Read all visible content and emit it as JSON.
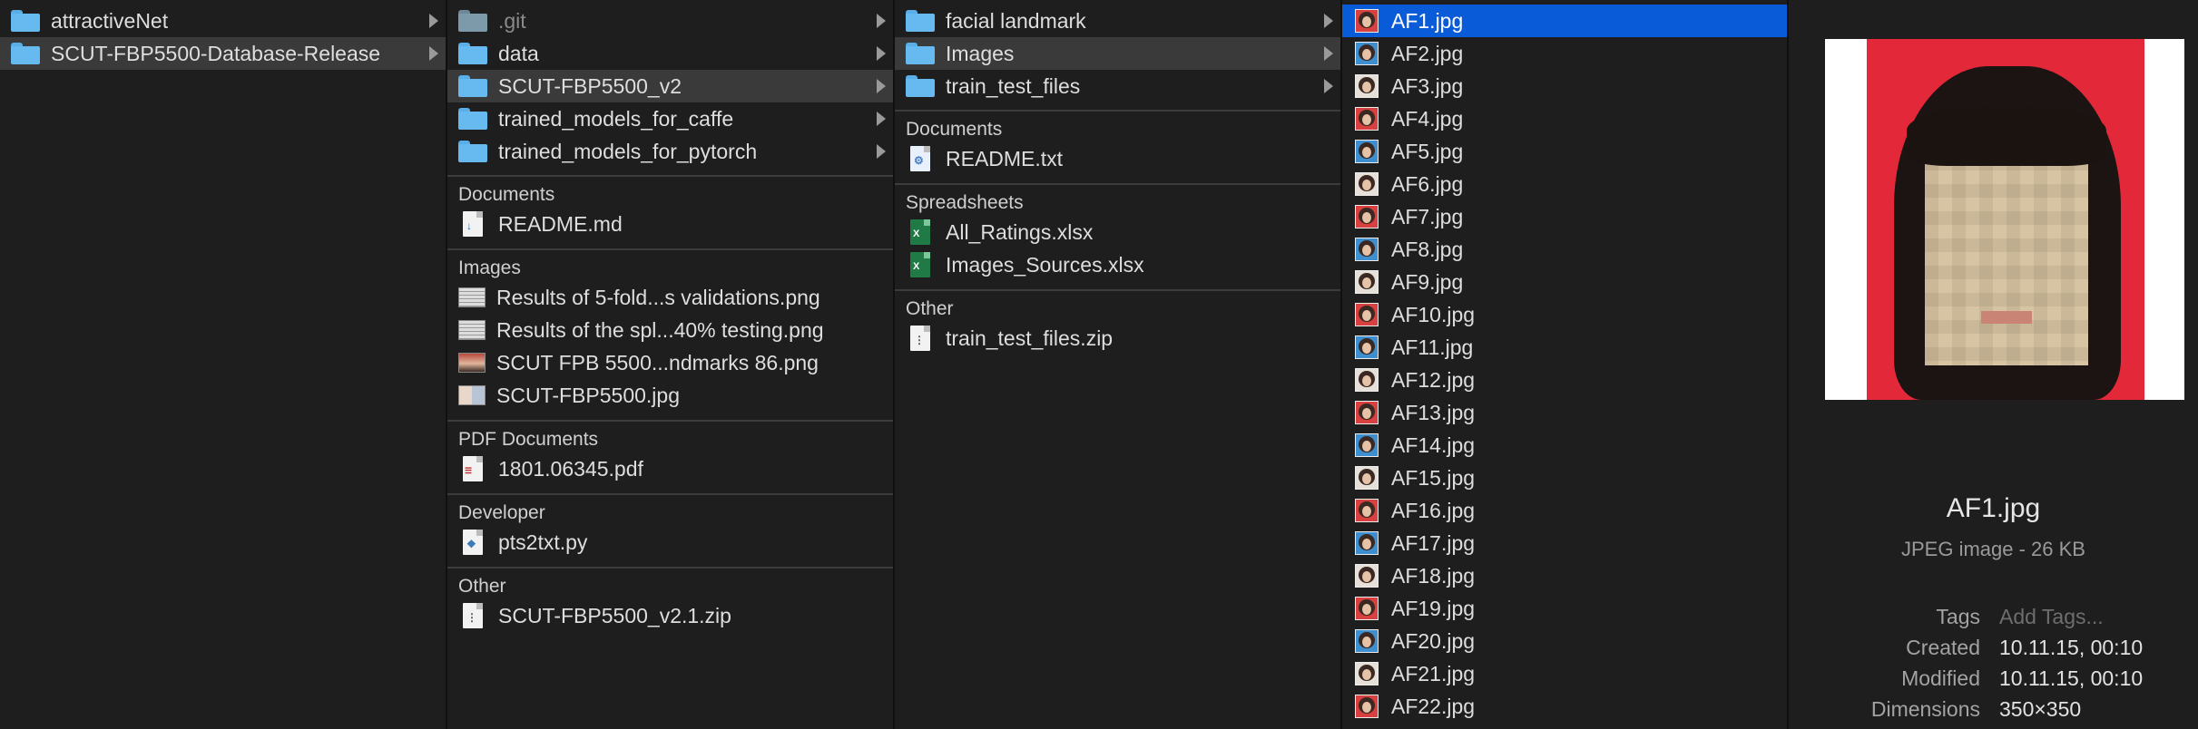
{
  "column1": {
    "items": [
      {
        "label": "attractiveNet"
      },
      {
        "label": "SCUT-FBP5500-Database-Release"
      }
    ]
  },
  "column2": {
    "folders": [
      {
        "label": ".git"
      },
      {
        "label": "data"
      },
      {
        "label": "SCUT-FBP5500_v2"
      },
      {
        "label": "trained_models_for_caffe"
      },
      {
        "label": "trained_models_for_pytorch"
      }
    ],
    "sections": {
      "documents": {
        "title": "Documents",
        "items": [
          "README.md"
        ]
      },
      "images": {
        "title": "Images",
        "items": [
          "Results of 5-fold...s validations.png",
          "Results of the spl...40% testing.png",
          "SCUT FPB 5500...ndmarks 86.png",
          "SCUT-FBP5500.jpg"
        ]
      },
      "pdf": {
        "title": "PDF Documents",
        "items": [
          "1801.06345.pdf"
        ]
      },
      "developer": {
        "title": "Developer",
        "items": [
          "pts2txt.py"
        ]
      },
      "other": {
        "title": "Other",
        "items": [
          "SCUT-FBP5500_v2.1.zip"
        ]
      }
    }
  },
  "column3": {
    "folders": [
      {
        "label": "facial landmark"
      },
      {
        "label": "Images"
      },
      {
        "label": "train_test_files"
      }
    ],
    "sections": {
      "documents": {
        "title": "Documents",
        "items": [
          "README.txt"
        ]
      },
      "spreadsheets": {
        "title": "Spreadsheets",
        "items": [
          "All_Ratings.xlsx",
          "Images_Sources.xlsx"
        ]
      },
      "other": {
        "title": "Other",
        "items": [
          "train_test_files.zip"
        ]
      }
    }
  },
  "column4": {
    "files": [
      "AF1.jpg",
      "AF2.jpg",
      "AF3.jpg",
      "AF4.jpg",
      "AF5.jpg",
      "AF6.jpg",
      "AF7.jpg",
      "AF8.jpg",
      "AF9.jpg",
      "AF10.jpg",
      "AF11.jpg",
      "AF12.jpg",
      "AF13.jpg",
      "AF14.jpg",
      "AF15.jpg",
      "AF16.jpg",
      "AF17.jpg",
      "AF18.jpg",
      "AF19.jpg",
      "AF20.jpg",
      "AF21.jpg",
      "AF22.jpg"
    ]
  },
  "preview": {
    "filename": "AF1.jpg",
    "kind": "JPEG image - 26 KB",
    "meta": {
      "tags_label": "Tags",
      "tags_value": "Add Tags...",
      "created_label": "Created",
      "created_value": "10.11.15, 00:10",
      "modified_label": "Modified",
      "modified_value": "10.11.15, 00:10",
      "dimensions_label": "Dimensions",
      "dimensions_value": "350×350"
    }
  },
  "colors": {
    "selection_blue": "#0a5bd7",
    "selection_grey": "#3a3a3a",
    "folder_blue": "#67baf0",
    "background": "#1e1e1e"
  },
  "icons": {
    "folder": "folder-icon",
    "chevron": "chevron-right-icon",
    "markdown": "markdown-file-icon",
    "png": "image-file-icon",
    "pdf": "pdf-file-icon",
    "python": "python-file-icon",
    "zip": "zip-file-icon",
    "text": "text-file-icon",
    "excel": "excel-file-icon",
    "jpg": "jpg-thumbnail-icon"
  }
}
